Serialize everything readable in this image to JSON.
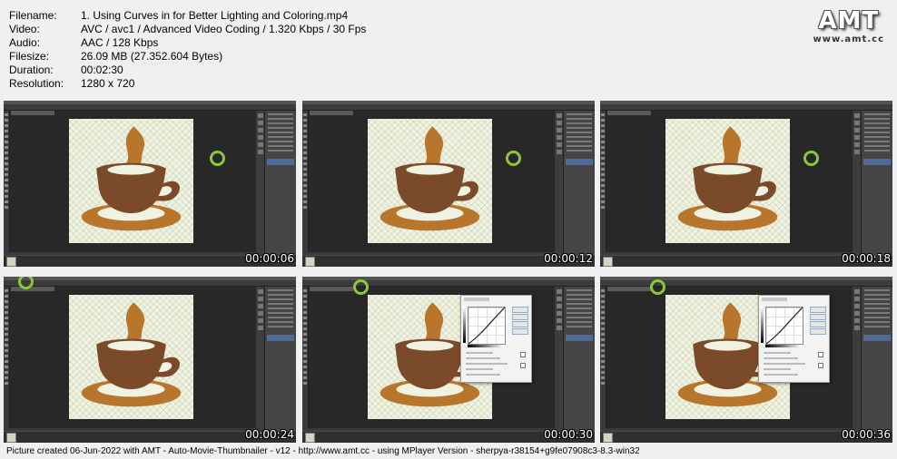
{
  "info": [
    {
      "key": "Filename:",
      "value": "1. Using Curves in for Better Lighting and Coloring.mp4"
    },
    {
      "key": "Video:",
      "value": "AVC / avc1 / Advanced Video Coding / 1.320 Kbps / 30 Fps"
    },
    {
      "key": "Audio:",
      "value": "AAC / 128 Kbps"
    },
    {
      "key": "Filesize:",
      "value": "26.09 MB (27.352.604 Bytes)"
    },
    {
      "key": "Duration:",
      "value": "00:02:30"
    },
    {
      "key": "Resolution:",
      "value": "1280 x 720"
    }
  ],
  "logo": {
    "main": "AMT",
    "url": "www.amt.cc"
  },
  "thumbnails": [
    {
      "timestamp": "00:00:06",
      "curves_dialog": false
    },
    {
      "timestamp": "00:00:12",
      "curves_dialog": false
    },
    {
      "timestamp": "00:00:18",
      "curves_dialog": false
    },
    {
      "timestamp": "00:00:24",
      "curves_dialog": false
    },
    {
      "timestamp": "00:00:30",
      "curves_dialog": true
    },
    {
      "timestamp": "00:00:36",
      "curves_dialog": true
    }
  ],
  "colors": {
    "cup": "#7b4a2a",
    "saucer": "#b8752c",
    "steam": "#b8752c",
    "cursor": "#8ec63f",
    "ps_dark": "#282828"
  },
  "footer": "Picture created 06-Jun-2022 with AMT - Auto-Movie-Thumbnailer - v12 - http://www.amt.cc - using MPlayer Version - sherpya-r38154+g9fe07908c3-8.3-win32"
}
